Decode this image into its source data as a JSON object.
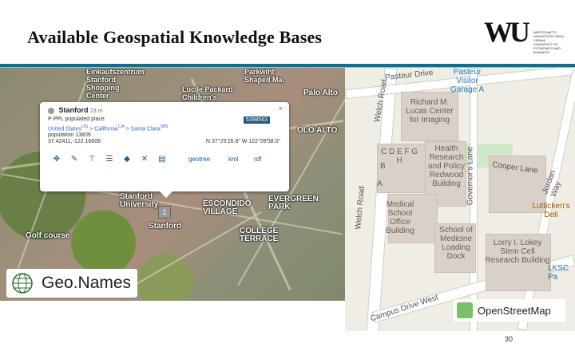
{
  "slide": {
    "title": "Available Geospatial Knowledge Bases",
    "page_number": "30",
    "accent_color": "#0f6f8f"
  },
  "logo": {
    "mark": "WU",
    "lines": "WIRTSCHAFTS UNIVERSITÄT WIEN VIENNA UNIVERSITY OF ECONOMICS AND BUSINESS"
  },
  "geonames": {
    "badge_label": "Geo.Names",
    "map_labels": {
      "einkaufszentrum": "Einkaufszentrum Stanford Shopping Center",
      "parkwith": "Parkwiht Shaped Ma.",
      "lucile": "Lucile Packard Children's Hospital",
      "palo_alto": "Palo Alto",
      "olo_alto": "OLO ALTO",
      "stanford_univ": "Stanford University",
      "escondido": "ESCONDIDO VILLAGE",
      "evergreen": "EVERGREEN PARK",
      "college_terrace": "COLLEGE TERRACE",
      "golf": "Golf course",
      "stanford": "Stanford",
      "marker_count": "1"
    },
    "popup": {
      "name": "Stanford",
      "distance": "23 m",
      "id": "5398563",
      "feature_code": "P PPL",
      "feature_desc": "populated place",
      "hierarchy": [
        "United States",
        "California",
        "Santa Clara"
      ],
      "hierarchy_sup": [
        "US",
        "CA",
        "085"
      ],
      "population_label": "population",
      "population": "13809",
      "coords_decimal": "37.42411,-122.16608",
      "coords_dms": "N 37°25'26.8\" W 122°09'58.0\"",
      "links": [
        "geotree",
        "kml",
        "rdf"
      ],
      "close": "×"
    }
  },
  "osm": {
    "badge_label": "OpenStreetMap",
    "roads": {
      "pasteur": "Pasteur Drive",
      "welch_top": "Welch Road",
      "welch_left": "Welch Road",
      "governors": "Governor's Lane",
      "cooper": "Cooper Lane",
      "jordan": "Jordan Way",
      "campus": "Campus Drive West"
    },
    "buildings": {
      "pasteur_garage": "Pasteur Visitor Garage A",
      "lucas": "Richard M. Lucas Center for Imaging",
      "cdefgh": "C D E F G H",
      "b": "B",
      "a": "A",
      "health": "Health Research and Policy Redwood Building",
      "medical": "Medical School Office Building",
      "school_med": "School of Medicine Loading Dock",
      "lorry": "Lorry I. Lokey Stem Cell Research Building",
      "lutticken": "Lutticken's Deli",
      "lksc": "LKSC Pa"
    }
  }
}
